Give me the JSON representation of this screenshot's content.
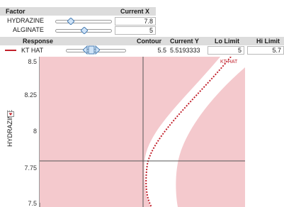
{
  "factor_table": {
    "header": {
      "factor": "Factor",
      "current_x": "Current X"
    },
    "rows": [
      {
        "name": "HYDRAZINE",
        "value": "7.8"
      },
      {
        "name": "ALGINATE",
        "value": "5"
      }
    ]
  },
  "response_table": {
    "header": {
      "response": "Response",
      "contour": "Contour",
      "current_y": "Current Y",
      "lo_limit": "Lo Limit",
      "hi_limit": "Hi Limit"
    },
    "row": {
      "name": "KT HAT",
      "contour": "5.5",
      "current_y": "5.5193333",
      "lo_limit": "5",
      "hi_limit": "5.7"
    }
  },
  "plot": {
    "y_axis_label": "HYDRAZINE",
    "y_ticks": [
      "8.5",
      "8.25",
      "8",
      "7.75",
      "7.5"
    ],
    "contour_label": "KT HAT",
    "colors": {
      "infeasible": "#f4c9cd",
      "feasible": "#ffffff",
      "contour_line": "#c2202b",
      "crosshair": "#555555"
    }
  }
}
